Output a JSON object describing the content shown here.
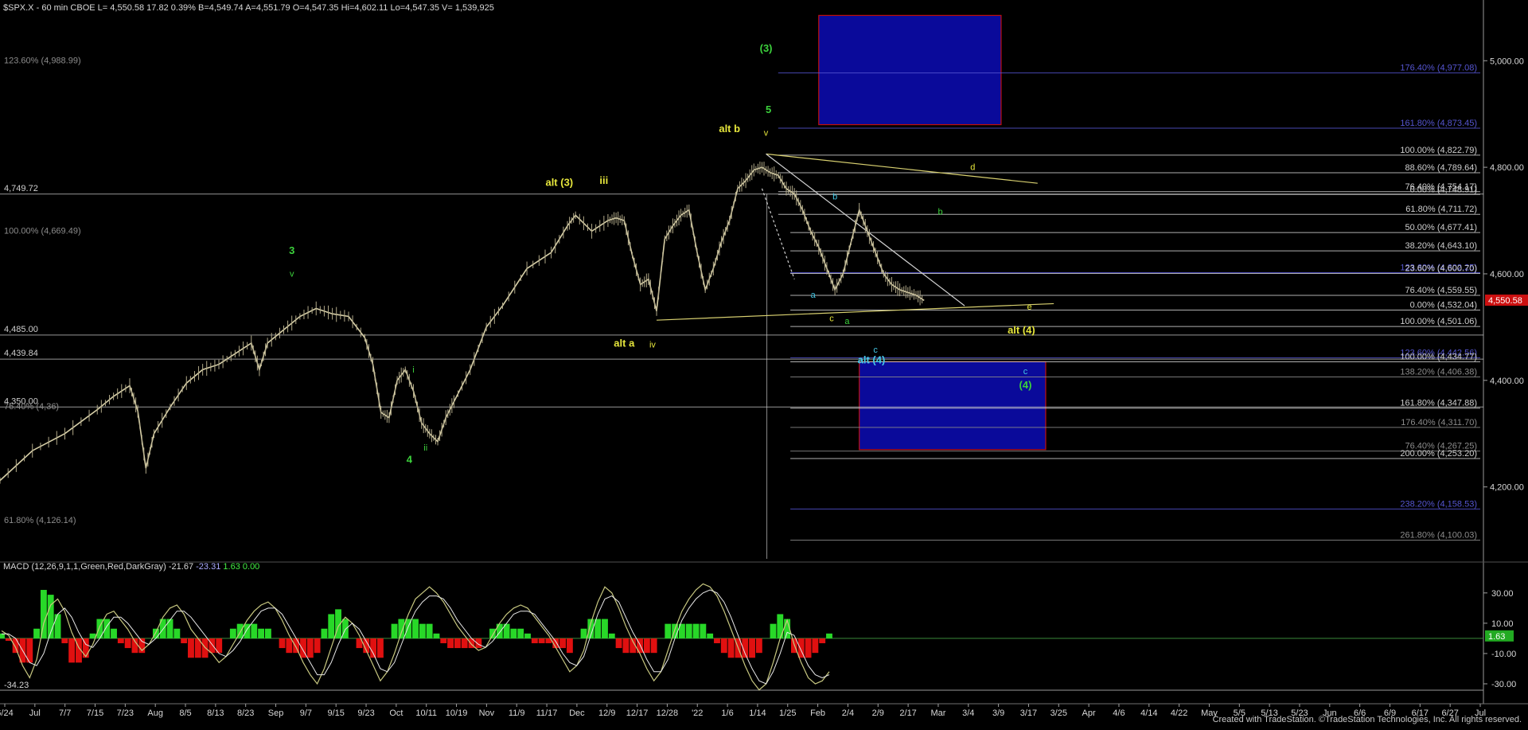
{
  "header": {
    "symbol": "$SPX.X",
    "interval": "60 min",
    "exchange": "CBOE",
    "last": "4,550.58",
    "change": "17.82",
    "change_pct": "0.39%",
    "bid": "B=4,549.74",
    "ask": "A=4,551.79",
    "open": "O=4,547.35",
    "high": "Hi=4,602.11",
    "low": "Lo=4,547.35",
    "volume": "1,539,925"
  },
  "footer": "Created with TradeStation. ©TradeStation Technologies, Inc. All rights reserved.",
  "colors": {
    "background": "#000000",
    "candle": "#d8d0a8",
    "wick": "#b0a888",
    "yellow_label": "#e6e63c",
    "green_label": "#3cd23c",
    "cyan_label": "#44c8e6",
    "fib_blue": "#5555d0",
    "fib_white": "#cfcfcf",
    "fib_gray": "#8c8c8c",
    "trend_yellow": "#d8d070",
    "box_fill": "#0a0a9a",
    "box_border": "#c01010",
    "macd_up": "#28d828",
    "macd_down": "#e01010",
    "macd_line": "#c8c880",
    "signal_line": "#e8e8e8",
    "price_tag_bg": "#cc1010"
  },
  "chart_data": [
    {
      "type": "line",
      "title": "$SPX.X - 60 min",
      "x_ticks": [
        "6/24",
        "Jul",
        "7/7",
        "7/15",
        "7/23",
        "Aug",
        "8/5",
        "8/13",
        "8/23",
        "Sep",
        "9/7",
        "9/15",
        "9/23",
        "Oct",
        "10/11",
        "10/19",
        "Nov",
        "11/9",
        "11/17",
        "Dec",
        "12/9",
        "12/17",
        "12/28",
        "'22",
        "1/6",
        "1/14",
        "1/25",
        "Feb",
        "2/4",
        "2/9",
        "2/17",
        "Mar",
        "3/4",
        "3/9",
        "3/17",
        "3/25",
        "Apr",
        "4/6",
        "4/14",
        "4/22",
        "May",
        "5/5",
        "5/13",
        "5/23",
        "Jun",
        "6/6",
        "6/9",
        "6/17",
        "6/27",
        "Jul"
      ],
      "y_ticks": [
        {
          "value": 5000,
          "label": "5,000.00"
        },
        {
          "value": 4800,
          "label": "4,800.00"
        },
        {
          "value": 4600,
          "label": "4,600.00"
        },
        {
          "value": 4400,
          "label": "4,400.00"
        },
        {
          "value": 4200,
          "label": "4,200.00"
        }
      ],
      "ylim": [
        4065,
        5105
      ],
      "last_price_tag": "4,550.58",
      "price_path": [
        [
          0,
          4212
        ],
        [
          4,
          4268
        ],
        [
          8,
          4300
        ],
        [
          12,
          4345
        ],
        [
          14,
          4370
        ],
        [
          16,
          4390
        ],
        [
          17,
          4342
        ],
        [
          18,
          4235
        ],
        [
          19,
          4300
        ],
        [
          21,
          4350
        ],
        [
          23,
          4395
        ],
        [
          25,
          4420
        ],
        [
          27,
          4430
        ],
        [
          29,
          4450
        ],
        [
          31,
          4470
        ],
        [
          32,
          4420
        ],
        [
          33,
          4470
        ],
        [
          35,
          4495
        ],
        [
          37,
          4520
        ],
        [
          39,
          4535
        ],
        [
          41,
          4525
        ],
        [
          43,
          4520
        ],
        [
          45,
          4480
        ],
        [
          46,
          4430
        ],
        [
          47,
          4340
        ],
        [
          48,
          4330
        ],
        [
          49,
          4400
        ],
        [
          50,
          4420
        ],
        [
          51,
          4380
        ],
        [
          52,
          4320
        ],
        [
          53,
          4300
        ],
        [
          54,
          4285
        ],
        [
          55,
          4330
        ],
        [
          56,
          4360
        ],
        [
          58,
          4420
        ],
        [
          60,
          4500
        ],
        [
          62,
          4540
        ],
        [
          65,
          4610
        ],
        [
          68,
          4640
        ],
        [
          70,
          4690
        ],
        [
          71,
          4710
        ],
        [
          73,
          4680
        ],
        [
          75,
          4700
        ],
        [
          76,
          4705
        ],
        [
          77,
          4700
        ],
        [
          78,
          4635
        ],
        [
          79,
          4580
        ],
        [
          80,
          4590
        ],
        [
          81,
          4530
        ],
        [
          82,
          4665
        ],
        [
          83,
          4690
        ],
        [
          84,
          4710
        ],
        [
          85,
          4720
        ],
        [
          86,
          4640
        ],
        [
          87,
          4570
        ],
        [
          88,
          4610
        ],
        [
          89,
          4660
        ],
        [
          90,
          4700
        ],
        [
          91,
          4760
        ],
        [
          92,
          4775
        ],
        [
          93,
          4795
        ],
        [
          94,
          4800
        ],
        [
          95,
          4790
        ],
        [
          96,
          4785
        ],
        [
          97,
          4760
        ],
        [
          98,
          4750
        ],
        [
          99,
          4720
        ],
        [
          100,
          4680
        ],
        [
          101,
          4650
        ],
        [
          102,
          4610
        ],
        [
          103,
          4570
        ],
        [
          104,
          4600
        ],
        [
          105,
          4660
        ],
        [
          106,
          4720
        ],
        [
          107,
          4680
        ],
        [
          108,
          4640
        ],
        [
          109,
          4600
        ],
        [
          110,
          4580
        ],
        [
          111,
          4570
        ],
        [
          112,
          4565
        ],
        [
          113,
          4560
        ],
        [
          114,
          4550
        ]
      ],
      "fib_levels": [
        {
          "label": "176.40% (4,977.08)",
          "value": 4977.08,
          "tone": "blue"
        },
        {
          "label": "161.80% (4,873.45)",
          "value": 4873.45,
          "tone": "blue"
        },
        {
          "label": "100.00% (4,822.79)",
          "value": 4822.79,
          "tone": "white"
        },
        {
          "label": "88.60% (4,789.64)",
          "value": 4789.64,
          "tone": "white"
        },
        {
          "label": "76.40% (4,754.17)",
          "value": 4754.17,
          "tone": "white"
        },
        {
          "label": "0.00% (4,748.91)",
          "value": 4748.91,
          "tone": "white"
        },
        {
          "label": "61.80% (4,711.72)",
          "value": 4711.72,
          "tone": "white"
        },
        {
          "label": "50.00% (4,677.41)",
          "value": 4677.41,
          "tone": "white"
        },
        {
          "label": "38.20% (4,643.10)",
          "value": 4643.1,
          "tone": "white"
        },
        {
          "label": "123.60% (4,602.25)",
          "value": 4602.25,
          "tone": "blue"
        },
        {
          "label": "23.60% (4,600.70)",
          "value": 4600.7,
          "tone": "white"
        },
        {
          "label": "76.40% (4,559.55)",
          "value": 4559.55,
          "tone": "white"
        },
        {
          "label": "0.00% (4,532.04)",
          "value": 4532.04,
          "tone": "white"
        },
        {
          "label": "100.00% (4,501.06)",
          "value": 4501.06,
          "tone": "white"
        },
        {
          "label": "123.60% (4,442.56)",
          "value": 4442.56,
          "tone": "blue"
        },
        {
          "label": "100.00% (4,434.77)",
          "value": 4434.77,
          "tone": "white"
        },
        {
          "label": "138.20% (4,406.38)",
          "value": 4406.38,
          "tone": "gray"
        },
        {
          "label": "161.80% (4,347.88)",
          "value": 4347.88,
          "tone": "white"
        },
        {
          "label": "176.40% (4,311.70)",
          "value": 4311.7,
          "tone": "gray"
        },
        {
          "label": "76.40% (4,267.25)",
          "value": 4267.25,
          "tone": "gray"
        },
        {
          "label": "200.00% (4,253.20)",
          "value": 4253.2,
          "tone": "white"
        },
        {
          "label": "238.20% (4,158.53)",
          "value": 4158.53,
          "tone": "blue"
        },
        {
          "label": "261.80% (4,100.03)",
          "value": 4100.03,
          "tone": "gray"
        }
      ],
      "left_levels": [
        {
          "label": "123.60% (4,988.99)",
          "value": 4988.99,
          "tone": "gray"
        },
        {
          "label": "4,749.72",
          "value": 4749.72,
          "tone": "white"
        },
        {
          "label": "100.00% (4,669.49)",
          "value": 4669.49,
          "tone": "gray"
        },
        {
          "label": "4,485.00",
          "value": 4485.0,
          "tone": "white"
        },
        {
          "label": "4,439.84",
          "value": 4439.84,
          "tone": "white"
        },
        {
          "label": "4,350.00",
          "value": 4350.0,
          "tone": "white"
        },
        {
          "label": "76.40% (4,36)",
          "value": 4340.0,
          "tone": "gray"
        },
        {
          "label": "61.80% (4,126.14)",
          "value": 4126.14,
          "tone": "gray"
        }
      ],
      "wave_labels": [
        {
          "text": "(3)",
          "color": "green",
          "x": 94.5,
          "y": 5017
        },
        {
          "text": "5",
          "color": "green",
          "x": 94.8,
          "y": 4902
        },
        {
          "text": "alt b",
          "color": "yellow",
          "x": 90,
          "y": 4866
        },
        {
          "text": "v",
          "color": "yellow",
          "x": 94.5,
          "y": 4859
        },
        {
          "text": "alt (3)",
          "color": "yellow",
          "x": 69,
          "y": 4765
        },
        {
          "text": "iii",
          "color": "yellow",
          "x": 74.5,
          "y": 4769
        },
        {
          "text": "d",
          "color": "yellow",
          "x": 120,
          "y": 4795
        },
        {
          "text": "b",
          "color": "cyan",
          "x": 103,
          "y": 4740
        },
        {
          "text": "b",
          "color": "green",
          "x": 116,
          "y": 4711
        },
        {
          "text": "3",
          "color": "green",
          "x": 36,
          "y": 4637
        },
        {
          "text": "v",
          "color": "green",
          "x": 36,
          "y": 4595
        },
        {
          "text": "a",
          "color": "cyan",
          "x": 100.3,
          "y": 4555
        },
        {
          "text": "c",
          "color": "yellow",
          "x": 102.6,
          "y": 4511
        },
        {
          "text": "a",
          "color": "green",
          "x": 104.5,
          "y": 4506
        },
        {
          "text": "e",
          "color": "yellow",
          "x": 127,
          "y": 4533
        },
        {
          "text": "alt (4)",
          "color": "yellow",
          "x": 126,
          "y": 4488
        },
        {
          "text": "alt a",
          "color": "yellow",
          "x": 77,
          "y": 4463
        },
        {
          "text": "iv",
          "color": "yellow",
          "x": 80.5,
          "y": 4462
        },
        {
          "text": "c",
          "color": "cyan",
          "x": 108,
          "y": 4452
        },
        {
          "text": "alt (4)",
          "color": "cyan",
          "x": 107.5,
          "y": 4432
        },
        {
          "text": "c",
          "color": "cyan",
          "x": 126.5,
          "y": 4412
        },
        {
          "text": "(4)",
          "color": "green",
          "x": 126.5,
          "y": 4385
        },
        {
          "text": "i",
          "color": "green",
          "x": 51,
          "y": 4415
        },
        {
          "text": "ii",
          "color": "green",
          "x": 52.5,
          "y": 4268
        },
        {
          "text": "4",
          "color": "green",
          "x": 50.5,
          "y": 4245
        }
      ],
      "trend_lines": [
        {
          "from": [
            94.5,
            4825
          ],
          "to": [
            128,
            4770
          ],
          "color": "yellow"
        },
        {
          "from": [
            81,
            4513
          ],
          "to": [
            130,
            4544
          ],
          "color": "yellow"
        },
        {
          "from": [
            94.5,
            4825
          ],
          "to": [
            119,
            4540
          ],
          "color": "white"
        },
        {
          "from": [
            94,
            4760
          ],
          "to": [
            98,
            4590
          ],
          "color": "white"
        }
      ],
      "boxes": [
        {
          "x0": 101,
          "x1": 123.5,
          "y0": 4880,
          "y1": 5085
        },
        {
          "x0": 106,
          "x1": 129,
          "y0": 4270,
          "y1": 4435
        }
      ],
      "divider_x": 94.6,
      "xlim": [
        0,
        183
      ]
    },
    {
      "type": "bar",
      "title": "MACD (12,26,9,1,1,Green,Red,DarkGray)",
      "macd": "-21.67",
      "signal": "-23.31",
      "histogram": "1.63",
      "zero_value": "0.00",
      "hist_tag": "1.63",
      "y_ticks": [
        {
          "value": 30,
          "label": "30.00"
        },
        {
          "value": 10,
          "label": "10.00"
        },
        {
          "value": -10,
          "label": "-10.00"
        },
        {
          "value": -30,
          "label": "-30.00"
        }
      ],
      "min_label": "-34.23",
      "min_value": -34.23,
      "ylim": [
        -40,
        42
      ],
      "macd_values": [
        5,
        2,
        -6,
        -18,
        -26,
        -14,
        10,
        22,
        26,
        18,
        4,
        -6,
        -12,
        -4,
        8,
        16,
        18,
        12,
        6,
        -2,
        -8,
        -4,
        4,
        14,
        20,
        22,
        16,
        6,
        0,
        -6,
        -10,
        -16,
        -12,
        -4,
        4,
        12,
        18,
        22,
        24,
        20,
        12,
        2,
        -6,
        -16,
        -24,
        -30,
        -20,
        -6,
        8,
        14,
        10,
        2,
        -8,
        -18,
        -28,
        -22,
        -10,
        4,
        16,
        26,
        30,
        34,
        30,
        24,
        16,
        8,
        2,
        -4,
        -8,
        -6,
        2,
        10,
        16,
        20,
        22,
        20,
        14,
        8,
        2,
        -6,
        -14,
        -22,
        -18,
        -8,
        10,
        24,
        34,
        30,
        20,
        8,
        -2,
        -10,
        -20,
        -28,
        -22,
        -8,
        6,
        18,
        26,
        32,
        36,
        34,
        28,
        18,
        6,
        -6,
        -18,
        -28,
        -34,
        -30,
        -16,
        0,
        12,
        -4,
        -16,
        -26,
        -30,
        -28,
        -22
      ],
      "signal_values": [
        3,
        3,
        0,
        -8,
        -16,
        -18,
        -10,
        4,
        16,
        20,
        14,
        4,
        -4,
        -6,
        0,
        8,
        14,
        14,
        10,
        4,
        -2,
        -4,
        0,
        6,
        12,
        18,
        18,
        14,
        8,
        2,
        -4,
        -10,
        -12,
        -8,
        -2,
        6,
        12,
        18,
        20,
        20,
        16,
        8,
        0,
        -8,
        -16,
        -24,
        -24,
        -16,
        -4,
        6,
        10,
        6,
        -2,
        -10,
        -20,
        -22,
        -16,
        -4,
        8,
        18,
        24,
        28,
        28,
        26,
        20,
        12,
        6,
        0,
        -4,
        -6,
        -2,
        4,
        10,
        16,
        18,
        18,
        16,
        10,
        4,
        -2,
        -10,
        -16,
        -18,
        -12,
        2,
        16,
        26,
        28,
        24,
        14,
        4,
        -4,
        -14,
        -22,
        -22,
        -14,
        0,
        12,
        20,
        26,
        30,
        32,
        30,
        24,
        14,
        2,
        -10,
        -20,
        -28,
        -30,
        -22,
        -10,
        4,
        2,
        -8,
        -18,
        -24,
        -26,
        -24
      ]
    }
  ]
}
